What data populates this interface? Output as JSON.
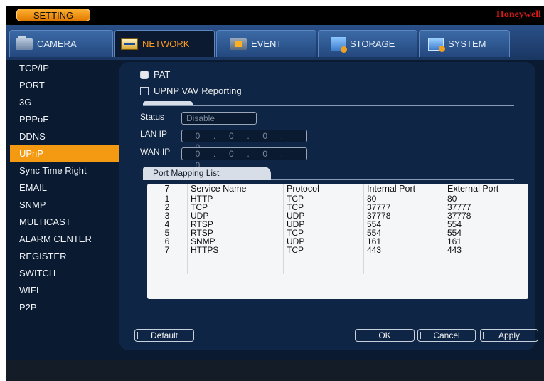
{
  "titlebar": {
    "setting_label": "SETTING",
    "brand": "Honeywell"
  },
  "tabs": [
    {
      "label": "CAMERA",
      "icon": "camera-icon"
    },
    {
      "label": "NETWORK",
      "icon": "network-icon",
      "active": true
    },
    {
      "label": "EVENT",
      "icon": "event-icon"
    },
    {
      "label": "STORAGE",
      "icon": "storage-icon"
    },
    {
      "label": "SYSTEM",
      "icon": "system-icon"
    }
  ],
  "sidebar": {
    "items": [
      {
        "label": "TCP/IP"
      },
      {
        "label": "PORT"
      },
      {
        "label": "3G"
      },
      {
        "label": "PPPoE"
      },
      {
        "label": "DDNS"
      },
      {
        "label": "UPnP",
        "active": true
      },
      {
        "label": "Sync Time Right"
      },
      {
        "label": "EMAIL"
      },
      {
        "label": "SNMP"
      },
      {
        "label": "MULTICAST"
      },
      {
        "label": "ALARM CENTER"
      },
      {
        "label": "REGISTER"
      },
      {
        "label": "SWITCH"
      },
      {
        "label": "WIFI"
      },
      {
        "label": "P2P"
      }
    ]
  },
  "upnp": {
    "pat_label": "PAT",
    "pat_checked": true,
    "upnp_vav_label": "UPNP VAV Reporting",
    "upnp_vav_checked": false,
    "status_label": "Status",
    "status_value": "Disable",
    "lan_ip_label": "LAN IP",
    "lan_ip": [
      "0",
      "0",
      "0",
      "0"
    ],
    "wan_ip_label": "WAN IP",
    "wan_ip": [
      "0",
      "0",
      "0",
      "0"
    ],
    "port_mapping_tab": "Port Mapping List"
  },
  "table": {
    "headers": [
      "7",
      "Service Name",
      "Protocol",
      "Internal Port",
      "External Port"
    ],
    "rows": [
      [
        "1",
        "HTTP",
        "TCP",
        "80",
        "80"
      ],
      [
        "2",
        "TCP",
        "TCP",
        "37777",
        "37777"
      ],
      [
        "3",
        "UDP",
        "UDP",
        "37778",
        "37778"
      ],
      [
        "4",
        "RTSP",
        "UDP",
        "554",
        "554"
      ],
      [
        "5",
        "RTSP",
        "TCP",
        "554",
        "554"
      ],
      [
        "6",
        "SNMP",
        "UDP",
        "161",
        "161"
      ],
      [
        "7",
        "HTTPS",
        "TCP",
        "443",
        "443"
      ]
    ]
  },
  "buttons": {
    "default": "Default",
    "ok": "OK",
    "cancel": "Cancel",
    "apply": "Apply"
  },
  "colors": {
    "accent": "#f49a12",
    "brand": "#e01818",
    "panel": "#0e2545"
  }
}
